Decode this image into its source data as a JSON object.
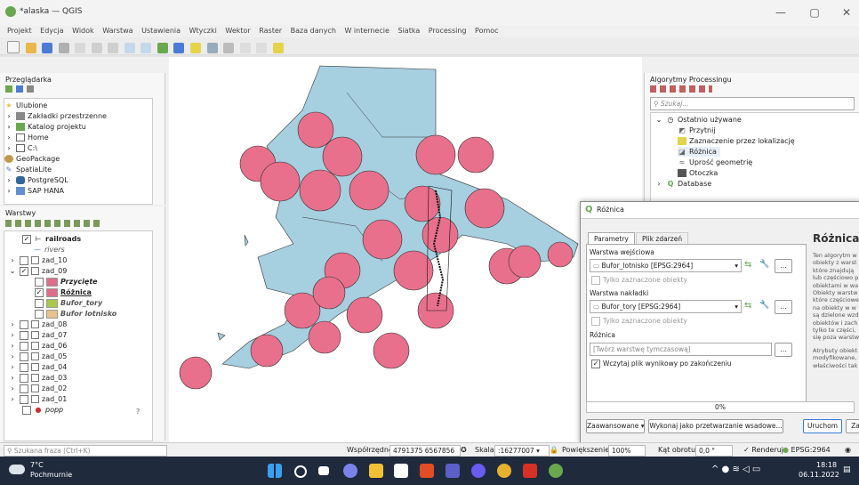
{
  "window": {
    "title": "*alaska — QGIS",
    "minimize": "—",
    "maximize": "▢",
    "close": "✕"
  },
  "menu": [
    "Projekt",
    "Edycja",
    "Widok",
    "Warstwa",
    "Ustawienia",
    "Wtyczki",
    "Wektor",
    "Raster",
    "Baza danych",
    "W internecie",
    "Siatka",
    "Processing",
    "Pomoc"
  ],
  "browser": {
    "title": "Przeglądarka",
    "items": [
      "Ulubione",
      "Zakładki przestrzenne",
      "Katalog projektu",
      "Home",
      "C:\\",
      "GeoPackage",
      "SpatiaLite",
      "PostgreSQL",
      "SAP HANA"
    ]
  },
  "layers": {
    "title": "Warstwy",
    "items": [
      {
        "label": "railroads",
        "checked": true,
        "bold": true
      },
      {
        "label": "rivers",
        "checked": false,
        "italic": true
      },
      {
        "label": "zad_10",
        "checked": false
      },
      {
        "label": "zad_09",
        "checked": true
      },
      {
        "label": "Przycięte",
        "checked": false,
        "italic": true,
        "color": "#e06c8a"
      },
      {
        "label": "Różnica",
        "checked": true,
        "bold": true,
        "color": "#e06c8a"
      },
      {
        "label": "Bufor_tory",
        "checked": false,
        "italic": true,
        "color": "#a8c94a"
      },
      {
        "label": "Bufor lotnisko",
        "checked": false,
        "italic": true,
        "color": "#e8c38a"
      },
      {
        "label": "zad_08",
        "checked": false
      },
      {
        "label": "zad_07",
        "checked": false
      },
      {
        "label": "zad_06",
        "checked": false
      },
      {
        "label": "zad_05",
        "checked": false
      },
      {
        "label": "zad_04",
        "checked": false
      },
      {
        "label": "zad_03",
        "checked": false
      },
      {
        "label": "zad_02",
        "checked": false
      },
      {
        "label": "zad_01",
        "checked": false
      },
      {
        "label": "popp",
        "checked": false,
        "italic": true
      }
    ],
    "help_mark": "?"
  },
  "processing": {
    "title": "Algorytmy Processingu",
    "search_placeholder": "Szukaj...",
    "recent_title": "Ostatnio używane",
    "recent": [
      "Przytnij",
      "Zaznaczenie przez lokalizację",
      "Różnica",
      "Uprość geometrię",
      "Otoczka"
    ],
    "database": "Database"
  },
  "dialog": {
    "title": "Różnica",
    "tabs": [
      "Parametry",
      "Plik zdarzeń"
    ],
    "input_label": "Warstwa wejściowa",
    "input_value": "Bufor_lotnisko [EPSG:2964]",
    "selected_only": "Tylko zaznaczone obiekty",
    "overlay_label": "Warstwa nakładki",
    "overlay_value": "Bufor_tory [EPSG:2964]",
    "output_label": "Różnica",
    "output_placeholder": "[Twórz warstwę tymczasową]",
    "open_output": "Wczytaj plik wynikowy po zakończeniu",
    "progress": "0%",
    "advanced": "Zaawansowane",
    "batch": "Wykonaj jako przetwarzanie wsadowe...",
    "run": "Uruchom",
    "close_btn": "Za",
    "help_title": "Różnica",
    "help_lines": [
      "Ten algorytm w",
      "obiekty z warst",
      "które znajdują",
      "lub częściowo p",
      "obiektami w wa",
      "Obiekty warstw",
      "które częściowe",
      "na obiekty w w",
      "są dzielone wzd",
      "obiektów i zach",
      "tylko te części,",
      "się poza warstw",
      "",
      "Atrybuty obiekt",
      "modyfikowane,",
      "właściwości tak"
    ]
  },
  "status": {
    "search_placeholder": "Szukana fraza (Ctrl+K)",
    "coord_label": "Współrzędne",
    "coord_value": "4791375 6567856",
    "scale_label": "Skala",
    "scale_value": ":16277007",
    "zoom_label": "Powiększenie",
    "zoom_value": "100%",
    "rotation_label": "Kąt obrotu",
    "rotation_value": "0,0 °",
    "render_label": "Renderuj",
    "crs": "EPSG:2964"
  },
  "taskbar": {
    "temp": "7°C",
    "weather": "Pochmurnie",
    "time": "18:18",
    "date": "06.11.2022"
  },
  "colors": {
    "land": "#a6cfe0",
    "buffer": "#e8708c",
    "accent": "#3a7bd5"
  }
}
